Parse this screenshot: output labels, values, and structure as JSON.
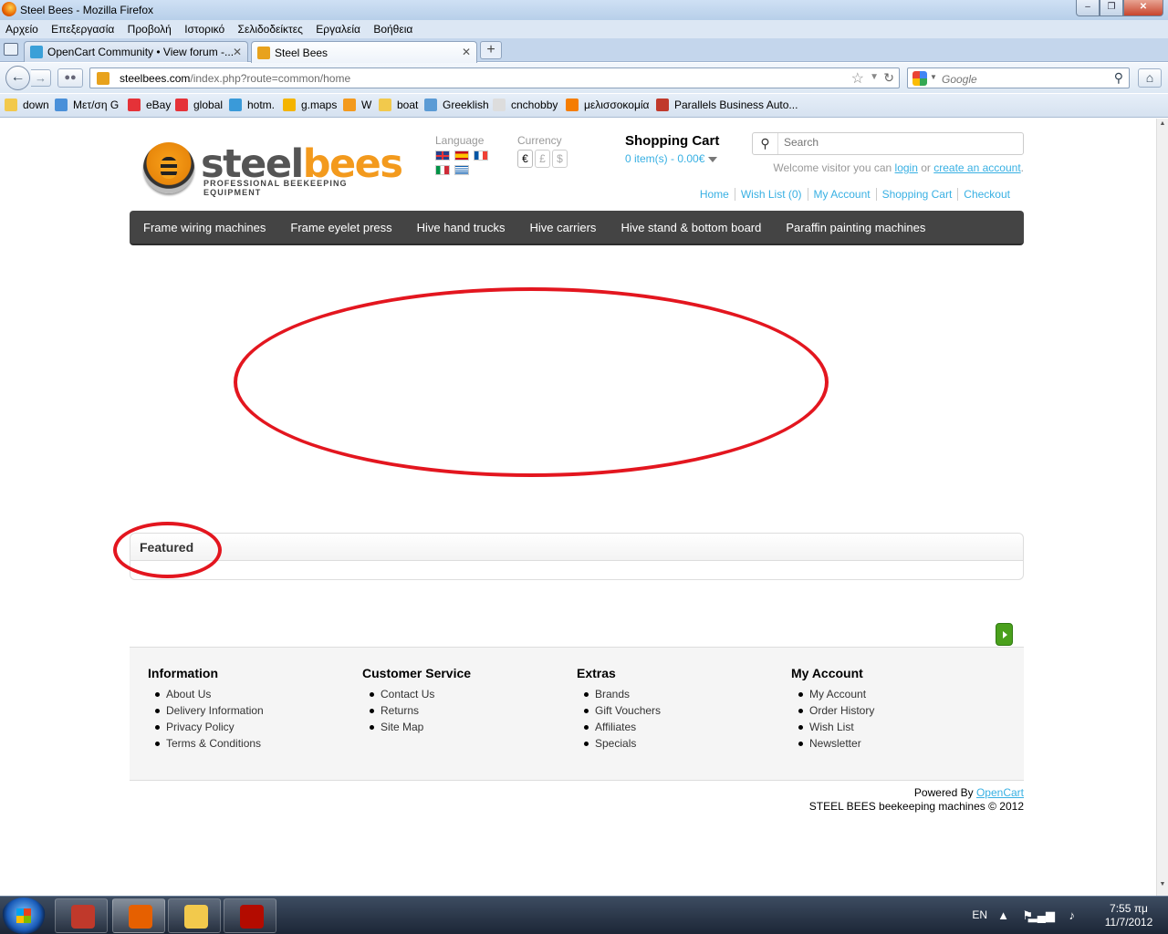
{
  "window": {
    "title": "Steel Bees - Mozilla Firefox",
    "controls": {
      "minimize": "–",
      "restore": "❐",
      "close": "✕"
    }
  },
  "menubar": [
    "Αρχείο",
    "Επεξεργασία",
    "Προβολή",
    "Ιστορικό",
    "Σελιδοδείκτες",
    "Εργαλεία",
    "Βοήθεια"
  ],
  "tabs": [
    {
      "label": "OpenCart Community • View forum -...",
      "active": false
    },
    {
      "label": "Steel Bees",
      "active": true
    }
  ],
  "tab_close_glyph": "✕",
  "new_tab_glyph": "+",
  "navbar": {
    "url_domain": "steelbees.com",
    "url_path": "/index.php?route=common/home",
    "search_placeholder": "Google"
  },
  "bookmarks": [
    {
      "label": "down",
      "icon": "folder-icon",
      "color": "#f2c94c"
    },
    {
      "label": "Μετ/ση G",
      "icon": "translate-icon",
      "color": "#4a90d9"
    },
    {
      "label": "eBay",
      "icon": "ebay-icon",
      "color": "#e53238"
    },
    {
      "label": "global",
      "icon": "ebay-icon",
      "color": "#e53238"
    },
    {
      "label": "hotm.",
      "icon": "windows-icon",
      "color": "#3a9ad9"
    },
    {
      "label": "g.maps",
      "icon": "maps-icon",
      "color": "#f4b400"
    },
    {
      "label": "W",
      "icon": "w-icon",
      "color": "#f39a1d"
    },
    {
      "label": "boat",
      "icon": "folder-icon",
      "color": "#f2c94c"
    },
    {
      "label": "Greeklish",
      "icon": "greeklish-icon",
      "color": "#5b9bd5"
    },
    {
      "label": "cnchobby",
      "icon": "page-icon",
      "color": "#dddddd"
    },
    {
      "label": "μελισσοκομία",
      "icon": "blogger-icon",
      "color": "#f57d00"
    },
    {
      "label": "Parallels Business Auto...",
      "icon": "parallels-icon",
      "color": "#c0392b"
    }
  ],
  "site": {
    "logo": {
      "steel": "steel",
      "bees": "bees",
      "tagline": "PROFESSIONAL BEEKEEPING EQUIPMENT"
    },
    "language_label": "Language",
    "flags": [
      {
        "name": "english-flag-icon",
        "bg": "linear-gradient(#e33 0 0) center/100% 2px no-repeat,linear-gradient(90deg,transparent 42%,#e33 42% 58%,transparent 58%),#27408b"
      },
      {
        "name": "spanish-flag-icon",
        "bg": "linear-gradient(#c60b1e 0 25%,#ffc400 25% 75%,#c60b1e 75%)"
      },
      {
        "name": "french-flag-icon",
        "bg": "linear-gradient(90deg,#0055a4 0 33%,#fff 33% 66%,#ef4135 66%)"
      },
      {
        "name": "italian-flag-icon",
        "bg": "linear-gradient(90deg,#009246 0 33%,#fff 33% 66%,#ce2b37 66%)"
      },
      {
        "name": "greek-flag-icon",
        "bg": "repeating-linear-gradient(#0d5eaf 0 1.2px,#fff 1.2px 2.4px)"
      }
    ],
    "currency_label": "Currency",
    "currencies": [
      {
        "symbol": "€",
        "selected": true
      },
      {
        "symbol": "£",
        "selected": false
      },
      {
        "symbol": "$",
        "selected": false
      }
    ],
    "cart": {
      "title": "Shopping Cart",
      "summary": "0 item(s) - 0.00€"
    },
    "search_placeholder": "Search",
    "welcome": {
      "prefix": "Welcome visitor you can ",
      "login": "login",
      "or": " or ",
      "create": "create an account",
      "suffix": "."
    },
    "toplinks": [
      "Home",
      "Wish List (0)",
      "My Account",
      "Shopping Cart",
      "Checkout"
    ],
    "menu": [
      "Frame wiring machines",
      "Frame eyelet press",
      "Hive hand trucks",
      "Hive carriers",
      "Hive stand & bottom board",
      "Paraffin painting machines"
    ],
    "featured_title": "Featured",
    "footer": [
      {
        "title": "Information",
        "items": [
          "About Us",
          "Delivery Information",
          "Privacy Policy",
          "Terms & Conditions"
        ]
      },
      {
        "title": "Customer Service",
        "items": [
          "Contact Us",
          "Returns",
          "Site Map"
        ]
      },
      {
        "title": "Extras",
        "items": [
          "Brands",
          "Gift Vouchers",
          "Affiliates",
          "Specials"
        ]
      },
      {
        "title": "My Account",
        "items": [
          "My Account",
          "Order History",
          "Wish List",
          "Newsletter"
        ]
      }
    ],
    "powered_by": "Powered By ",
    "powered_link": "OpenCart",
    "copyright": "STEEL BEES beekeeping machines © 2012"
  },
  "taskbar": {
    "apps": [
      {
        "name": "autocad-app",
        "color": "#c0392b",
        "active": false
      },
      {
        "name": "firefox-app",
        "color": "#e66000",
        "active": true
      },
      {
        "name": "explorer-app",
        "color": "#f2c94c",
        "active": false
      },
      {
        "name": "acrobat-app",
        "color": "#b30b00",
        "active": false
      }
    ],
    "lang": "EN",
    "time": "7:55 πμ",
    "date": "11/7/2012"
  },
  "colors": {
    "link": "#38b0e3",
    "annotation_red": "#e3161f",
    "menu_bg": "#444444",
    "accent_orange": "#f39a1d"
  }
}
